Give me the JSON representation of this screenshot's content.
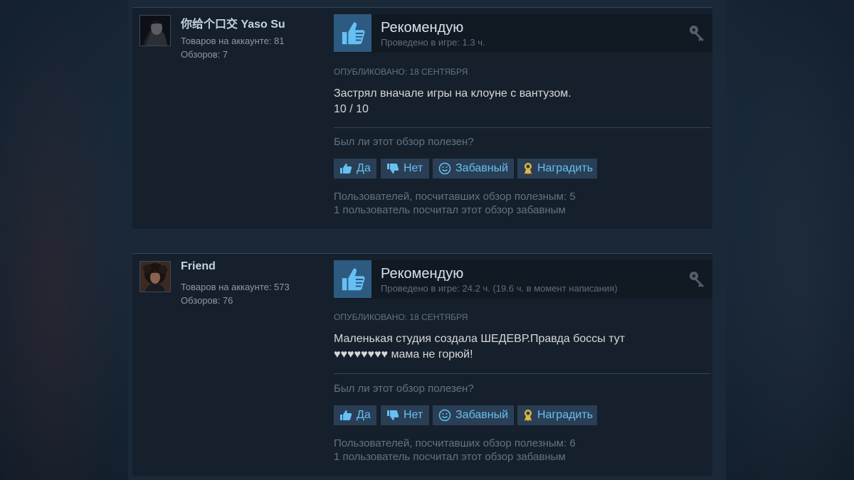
{
  "reviews": [
    {
      "author": {
        "name": "你给个口交 Yaso Su",
        "products": "Товаров на аккаунте: 81",
        "reviews": "Обзоров: 7"
      },
      "recommendation": "Рекомендую",
      "hours": "Проведено в игре: 1.3 ч.",
      "posted": "ОПУБЛИКОВАНО: 18 СЕНТЯБРЯ",
      "content": [
        "Застрял вначале игры на клоуне с вантузом.",
        "10 / 10"
      ],
      "helpful_question": "Был ли этот обзор полезен?",
      "buttons": {
        "yes": "Да",
        "no": "Нет",
        "funny": "Забавный",
        "award": "Наградить"
      },
      "stats": [
        "Пользователей, посчитавших обзор полезным: 5",
        "1 пользователь посчитал этот обзор забавным"
      ]
    },
    {
      "author": {
        "name": "Friend",
        "products": "Товаров на аккаунте: 573",
        "reviews": "Обзоров: 76"
      },
      "recommendation": "Рекомендую",
      "hours": "Проведено в игре: 24.2 ч. (19.6 ч. в момент написания)",
      "posted": "ОПУБЛИКОВАНО: 18 СЕНТЯБРЯ",
      "content": [
        "Маленькая студия создала ШЕДЕВР.Правда боссы тут",
        "♥♥♥♥♥♥♥♥ мама не горюй!"
      ],
      "helpful_question": "Был ли этот обзор полезен?",
      "buttons": {
        "yes": "Да",
        "no": "Нет",
        "funny": "Забавный",
        "award": "Наградить"
      },
      "stats": [
        "Пользователей, посчитавших обзор полезным: 6",
        "1 пользователь посчитал этот обзор забавным"
      ]
    }
  ],
  "icons": {
    "recommend": "thumbs-up-icon",
    "product_key": "key-icon",
    "yes": "thumbs-up-icon",
    "no": "thumbs-down-icon",
    "funny": "smiley-icon",
    "award": "award-ribbon-icon"
  },
  "colors": {
    "accent": "#66c0f4",
    "thumb_bg": "#2d5a80",
    "award_gold": "#e7b73a"
  }
}
